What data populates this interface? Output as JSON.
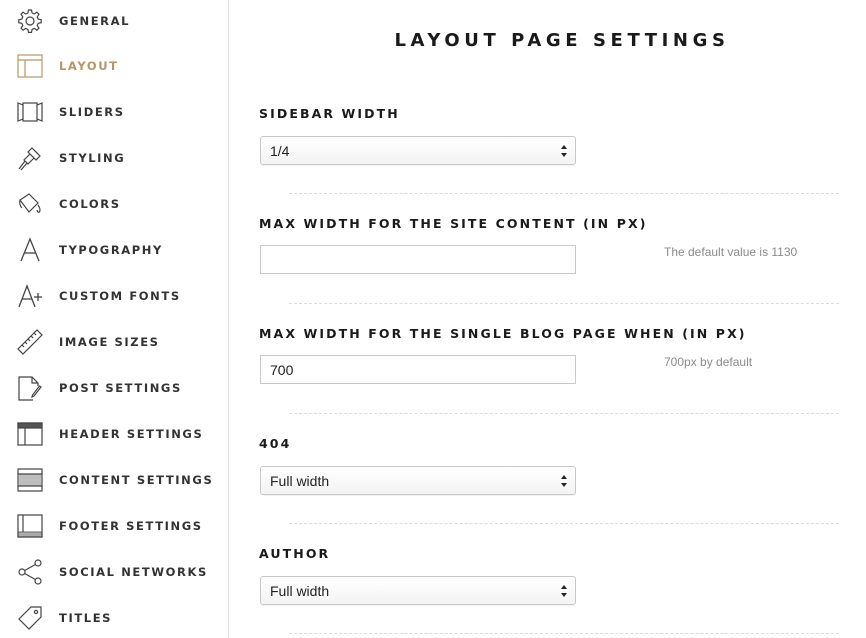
{
  "sidebar": {
    "items": [
      {
        "label": "GENERAL",
        "icon": "gear-icon"
      },
      {
        "label": "LAYOUT",
        "icon": "layout-icon",
        "active": true
      },
      {
        "label": "SLIDERS",
        "icon": "slider-icon"
      },
      {
        "label": "STYLING",
        "icon": "paintbrush-icon"
      },
      {
        "label": "COLORS",
        "icon": "paint-bucket-icon"
      },
      {
        "label": "TYPOGRAPHY",
        "icon": "typography-icon"
      },
      {
        "label": "CUSTOM FONTS",
        "icon": "custom-font-icon"
      },
      {
        "label": "IMAGE SIZES",
        "icon": "ruler-icon"
      },
      {
        "label": "POST SETTINGS",
        "icon": "post-edit-icon"
      },
      {
        "label": "HEADER SETTINGS",
        "icon": "header-layout-icon"
      },
      {
        "label": "CONTENT SETTINGS",
        "icon": "content-layout-icon"
      },
      {
        "label": "FOOTER SETTINGS",
        "icon": "footer-layout-icon"
      },
      {
        "label": "SOCIAL NETWORKS",
        "icon": "share-icon"
      },
      {
        "label": "TITLES",
        "icon": "tag-icon"
      }
    ],
    "active_color": "#b89564"
  },
  "main": {
    "title": "LAYOUT PAGE SETTINGS",
    "fields": [
      {
        "label": "SIDEBAR WIDTH",
        "type": "select",
        "value": "1/4",
        "hint": ""
      },
      {
        "label": "MAX WIDTH FOR THE SITE CONTENT (IN PX)",
        "type": "input",
        "value": "",
        "hint": "The default value is 1130"
      },
      {
        "label": "MAX WIDTH FOR THE SINGLE BLOG PAGE WHEN (IN PX)",
        "type": "input",
        "value": "700",
        "hint": "700px by default"
      },
      {
        "label": "404",
        "type": "select",
        "value": "Full width",
        "hint": ""
      },
      {
        "label": "AUTHOR",
        "type": "select",
        "value": "Full width",
        "hint": ""
      }
    ]
  }
}
